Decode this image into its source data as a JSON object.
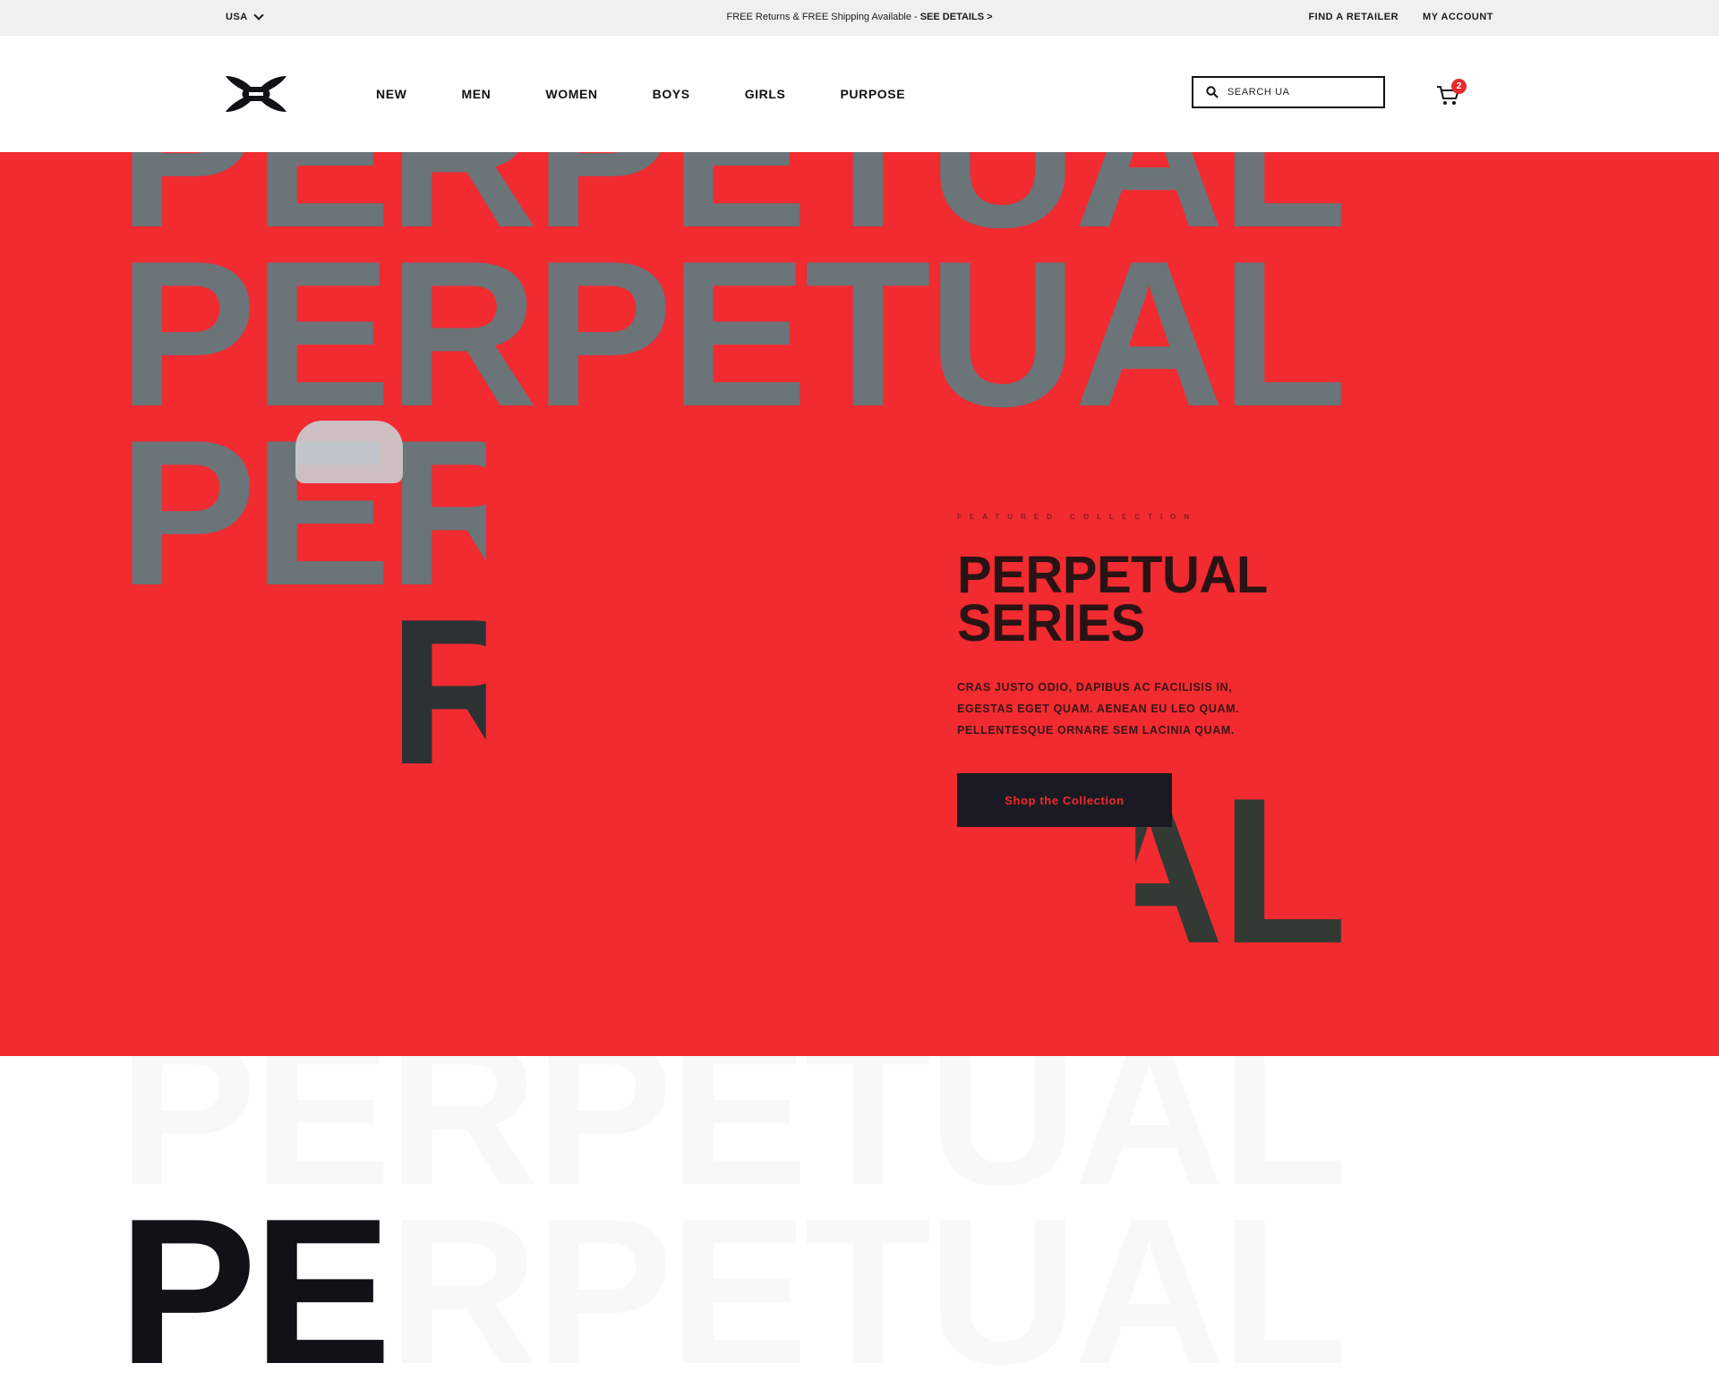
{
  "topbar": {
    "country": "USA",
    "promo_text": "FREE Returns & FREE Shipping Available - ",
    "promo_link": "SEE DETAILS >",
    "find_retailer": "FIND A RETAILER",
    "my_account": "MY ACCOUNT"
  },
  "nav": {
    "items": [
      "NEW",
      "MEN",
      "WOMEN",
      "BOYS",
      "GIRLS",
      "PURPOSE"
    ]
  },
  "search": {
    "placeholder": "SEARCH UA"
  },
  "cart": {
    "count": "2"
  },
  "hero": {
    "background_word": "PERPETUAL",
    "eyebrow": "FEATURED COLLECTION",
    "title_line1": "PERPETUAL",
    "title_line2": "SERIES",
    "description": "CRAS JUSTO ODIO, DAPIBUS AC FACILISIS IN, EGESTAS EGET QUAM. AENEAN EU LEO QUAM. PELLENTESQUE ORNARE SEM LACINIA QUAM.",
    "cta_label": "Shop the Collection",
    "bottom_word": "PE"
  },
  "colors": {
    "hero_red": "#f12b30",
    "cta_bg": "#1a1a22",
    "text_dark": "#111116"
  },
  "icons": [
    "chevron-down-icon",
    "under-armour-logo",
    "search-icon",
    "cart-icon"
  ]
}
